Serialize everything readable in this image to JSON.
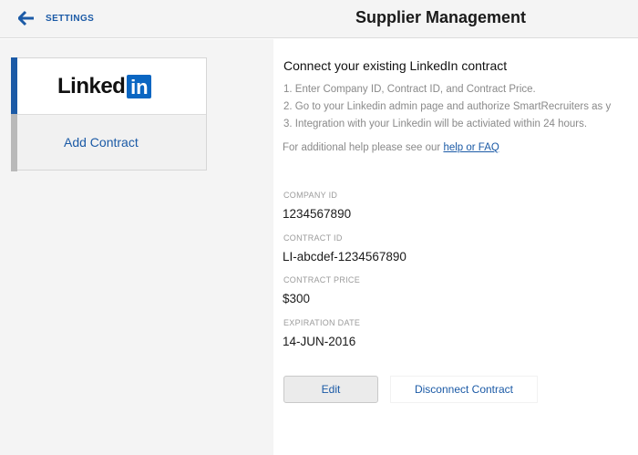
{
  "header": {
    "back_label": "SETTINGS",
    "back_icon": "left-arrow-icon",
    "title": "Supplier Management"
  },
  "sidebar": {
    "card": {
      "logo_text": "Linked",
      "logo_badge": "in",
      "action_label": "Add Contract"
    }
  },
  "main": {
    "section_title": "Connect your existing LinkedIn contract",
    "steps": [
      "1. Enter Company ID, Contract ID, and Contract Price.",
      "2. Go to your Linkedin admin page and authorize SmartRecruiters as y",
      "3. Integration with your Linkedin will be activiated within 24 hours."
    ],
    "help_text": "For additional help please see our ",
    "help_link": "help or FAQ",
    "fields": [
      {
        "label": "COMPANY ID",
        "value": "1234567890"
      },
      {
        "label": "CONTRACT ID",
        "value": "LI-abcdef-1234567890"
      },
      {
        "label": "CONTRACT PRICE",
        "value": "$300"
      },
      {
        "label": "EXPIRATION DATE",
        "value": "14-JUN-2016"
      }
    ],
    "edit_label": "Edit",
    "disconnect_label": "Disconnect Contract"
  },
  "colors": {
    "accent": "#1b5aa6",
    "linkedin_blue": "#0a66c2",
    "topbar_bg": "#f4f4f4"
  }
}
